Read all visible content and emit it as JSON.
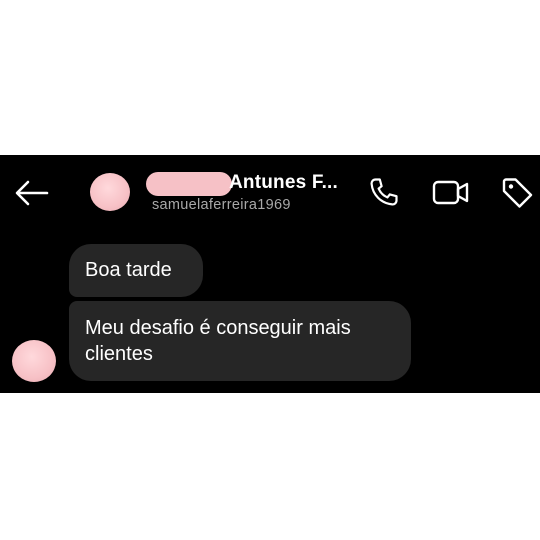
{
  "header": {
    "back_icon": "arrow-left-icon",
    "contact_name": "Antunes F...",
    "username": "samuelaferreira1969",
    "actions": [
      {
        "name": "phone-call",
        "icon": "phone-icon"
      },
      {
        "name": "video-call",
        "icon": "video-camera-icon"
      },
      {
        "name": "tag",
        "icon": "tag-icon"
      }
    ]
  },
  "messages": [
    {
      "text": "Boa tarde"
    },
    {
      "text": "Meu desafio é conseguir mais clientes"
    }
  ],
  "colors": {
    "background": "#000000",
    "bubble": "#262626",
    "text": "#ffffff",
    "secondary_text": "#a8a8a8",
    "redaction": "#f6c1c6"
  }
}
